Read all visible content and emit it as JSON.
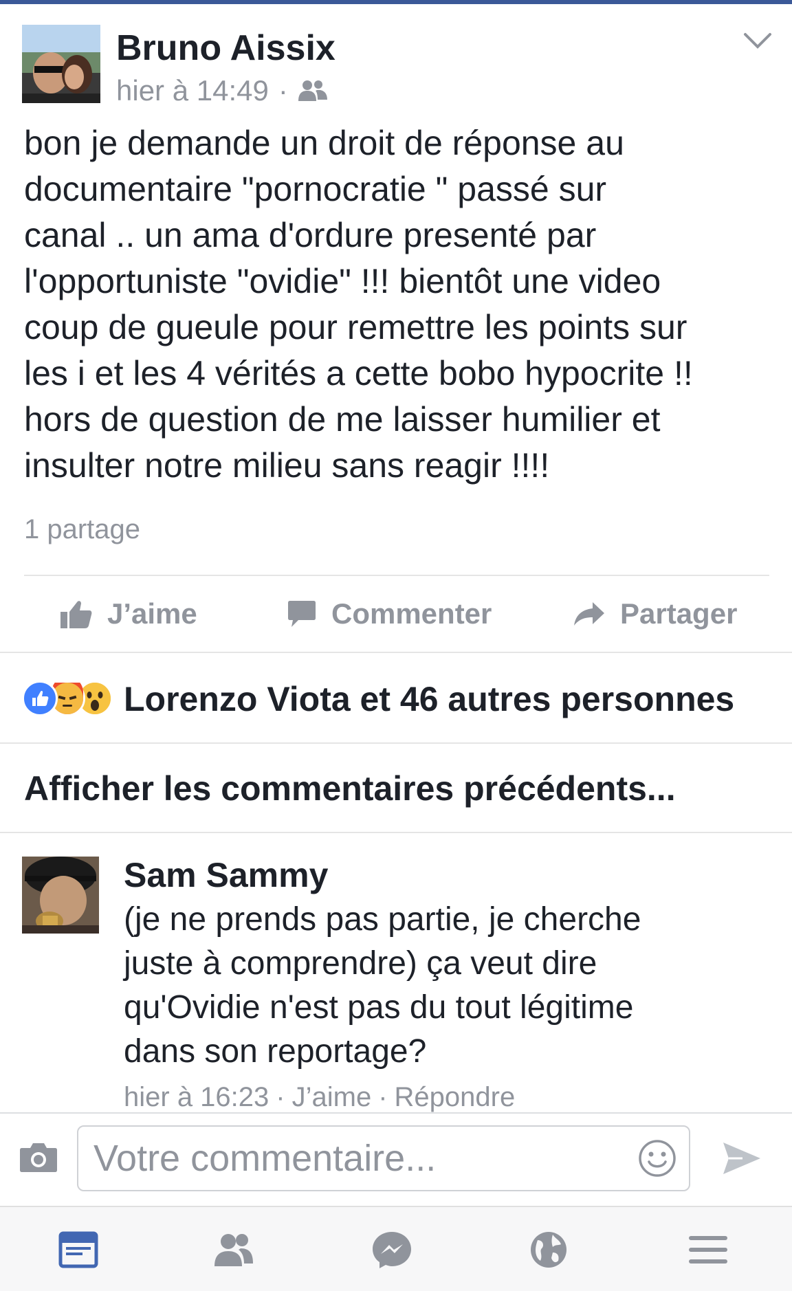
{
  "post": {
    "author": "Bruno Aissix",
    "timestamp": "hier à 14:49",
    "separator": "·",
    "audience_icon": "friends-icon",
    "text": "bon je demande un droit de réponse au\ndocumentaire \"pornocratie \" passé sur\ncanal .. un ama  d'ordure presenté par\nl'opportuniste \"ovidie\" !!! bientôt une video\ncoup de gueule pour remettre les points sur\nles i et les 4 vérités a cette bobo hypocrite !!\nhors de question de me laisser humilier et\ninsulter notre milieu sans reagir !!!!",
    "shares": "1 partage"
  },
  "actions": {
    "like": "J’aime",
    "comment": "Commenter",
    "share": "Partager"
  },
  "reactions": {
    "icons": [
      "like-reaction-icon",
      "angry-reaction-icon",
      "wow-reaction-icon"
    ],
    "text": "Lorenzo Viota et 46 autres personnes"
  },
  "previous_comments": "Afficher les commentaires précédents...",
  "comment": {
    "author": "Sam Sammy",
    "text": "(je ne prends pas partie, je cherche\njuste à comprendre) ça veut dire\nqu'Ovidie n'est pas du tout légitime\ndans son reportage?",
    "time": "hier à 16:23",
    "sep": "·",
    "like": "J’aime",
    "reply": "Répondre"
  },
  "composer": {
    "placeholder": "Votre commentaire..."
  },
  "nav": [
    "news-feed-icon",
    "friends-icon",
    "messenger-icon",
    "notifications-globe-icon",
    "menu-icon"
  ],
  "colors": {
    "brand": "#3b5998",
    "active_nav": "#4267b2",
    "muted": "#90949c",
    "like_blue": "#4080ff",
    "angry": "#f25c3b",
    "wow": "#f7c341"
  }
}
